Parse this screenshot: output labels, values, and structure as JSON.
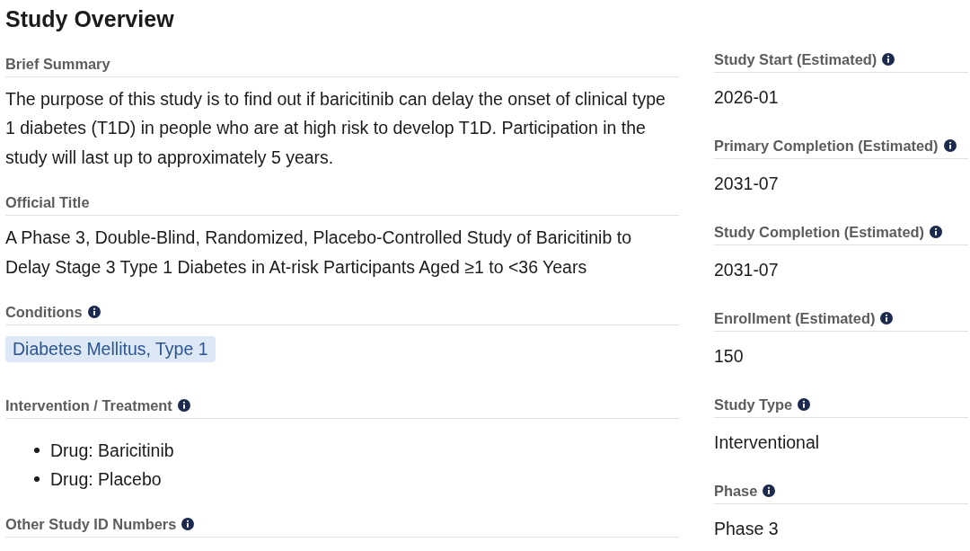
{
  "title": "Study Overview",
  "sections": [
    {
      "label": "Brief Summary",
      "info": false,
      "kind": "text",
      "text": "The purpose of this study is to find out if baricitinib can delay the onset of clinical type 1 diabetes (T1D) in people who are at high risk to develop T1D. Participation in the study will last up to approximately 5 years."
    },
    {
      "label": "Official Title",
      "info": false,
      "kind": "text",
      "text": "A Phase 3, Double-Blind, Randomized, Placebo-Controlled Study of Baricitinib to Delay Stage 3 Type 1 Diabetes in At-risk Participants Aged ≥1 to <36 Years"
    },
    {
      "label": "Conditions",
      "info": true,
      "kind": "tags",
      "tags": [
        "Diabetes Mellitus, Type 1"
      ]
    },
    {
      "label": "Intervention / Treatment",
      "info": true,
      "kind": "list",
      "items": [
        "Drug: Baricitinib",
        "Drug: Placebo"
      ]
    },
    {
      "label": "Other Study ID Numbers",
      "info": true
    }
  ],
  "details": [
    {
      "label": "Study Start (Estimated)",
      "info": true,
      "value": "2026-01"
    },
    {
      "label": "Primary Completion (Estimated)",
      "info": true,
      "value": "2031-07"
    },
    {
      "label": "Study Completion (Estimated)",
      "info": true,
      "value": "2031-07"
    },
    {
      "label": "Enrollment (Estimated)",
      "info": true,
      "value": "150"
    },
    {
      "label": "Study Type",
      "info": true,
      "value": "Interventional"
    },
    {
      "label": "Phase",
      "info": true,
      "value": "Phase 3"
    }
  ]
}
